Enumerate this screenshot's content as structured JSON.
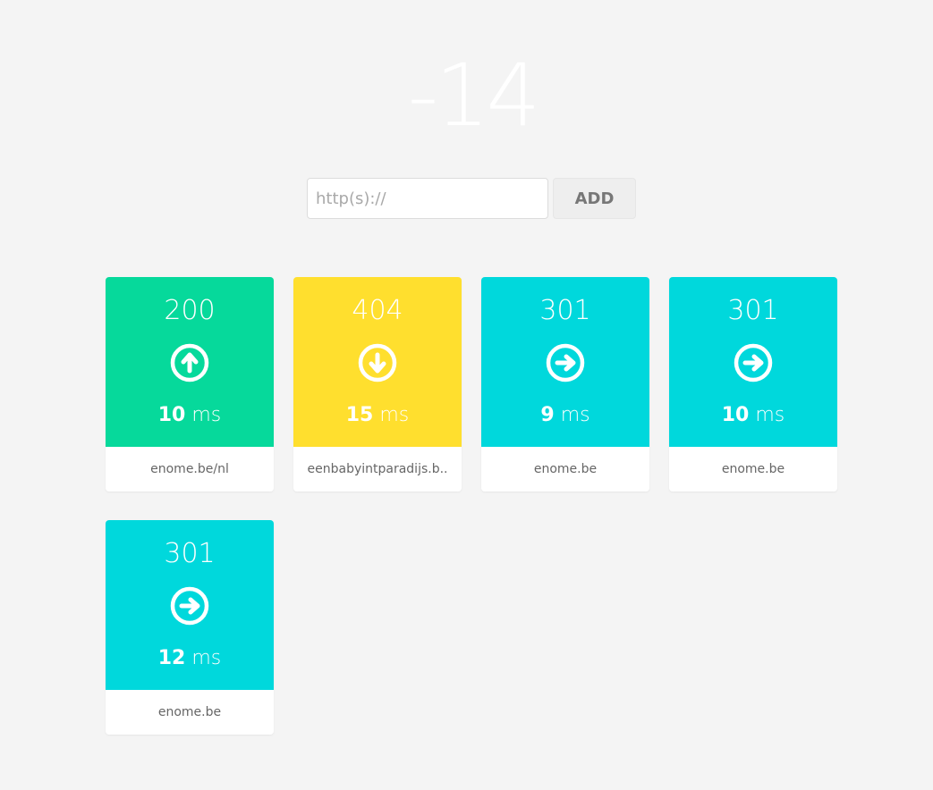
{
  "counter": "-14",
  "form": {
    "url_placeholder": "http(s)://",
    "url_value": "",
    "add_label": "ADD"
  },
  "colors": {
    "green": "#06d99b",
    "yellow": "#ffdf2e",
    "cyan": "#00d8dc"
  },
  "cards": [
    {
      "status": "200",
      "time_value": "10",
      "time_unit": "ms",
      "url": "enome.be/nl",
      "icon": "arrow-up-circle-icon",
      "color": "#06d99b"
    },
    {
      "status": "404",
      "time_value": "15",
      "time_unit": "ms",
      "url": "eenbabyintparadijs.b..",
      "icon": "arrow-down-circle-icon",
      "color": "#ffdf2e"
    },
    {
      "status": "301",
      "time_value": "9",
      "time_unit": "ms",
      "url": "enome.be",
      "icon": "arrow-right-circle-icon",
      "color": "#00d8dc"
    },
    {
      "status": "301",
      "time_value": "10",
      "time_unit": "ms",
      "url": "enome.be",
      "icon": "arrow-right-circle-icon",
      "color": "#00d8dc"
    },
    {
      "status": "301",
      "time_value": "12",
      "time_unit": "ms",
      "url": "enome.be",
      "icon": "arrow-right-circle-icon",
      "color": "#00d8dc"
    }
  ]
}
